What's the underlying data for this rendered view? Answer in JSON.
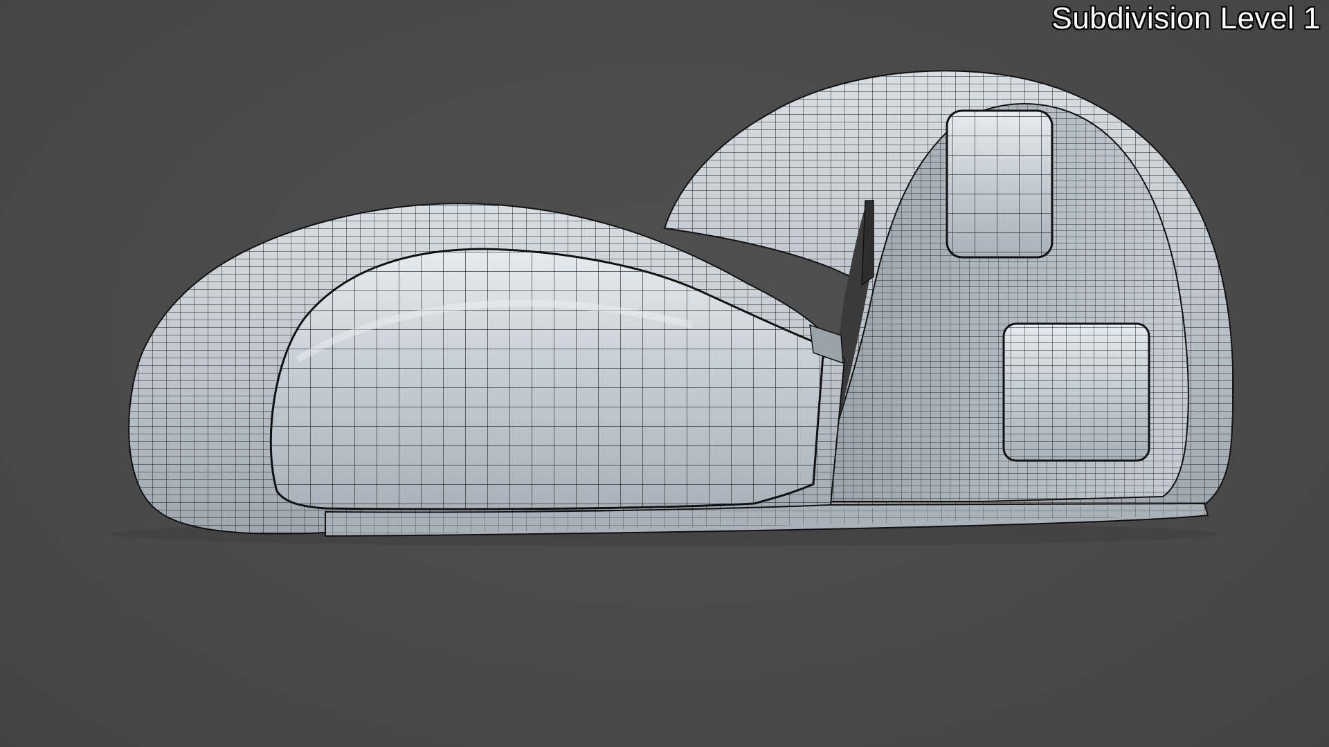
{
  "viewport": {
    "overlay_label": "Subdivision Level 1",
    "background_color": "#4b4b4b",
    "mesh_fill_color": "#b9c0c8",
    "mesh_wire_color": "#1a1a1a",
    "display_mode": "wireframe-on-shaded"
  },
  "model": {
    "icon": "pod-structure-mesh-icon"
  }
}
